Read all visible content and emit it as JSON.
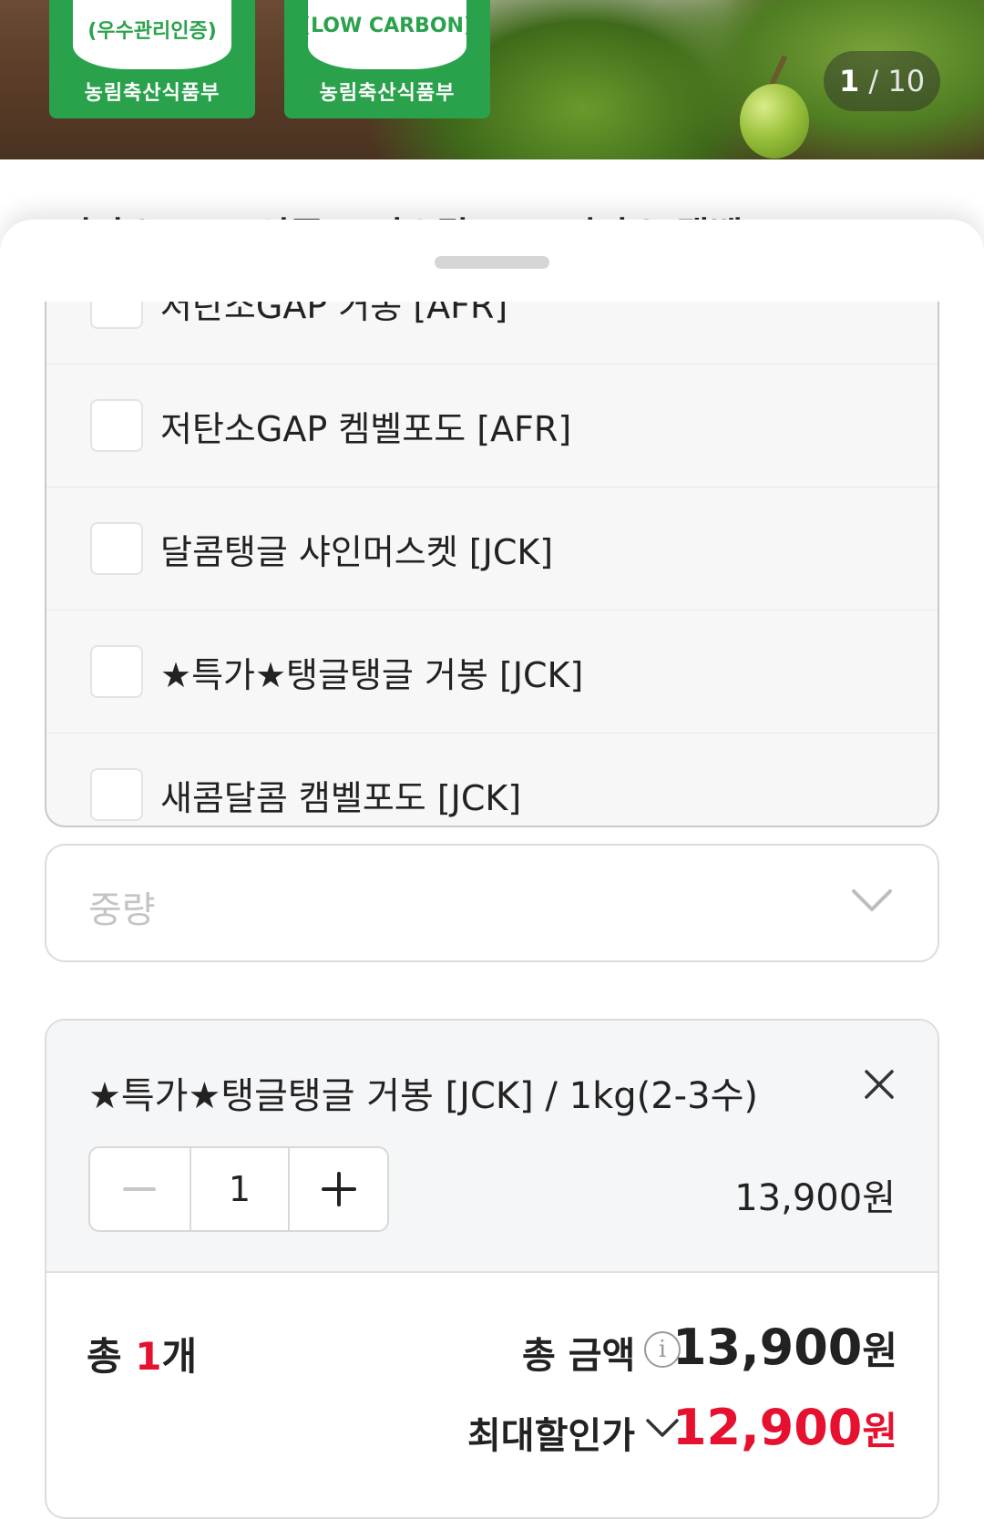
{
  "hero": {
    "badges": [
      {
        "sub": "(우수관리인증)",
        "ministry": "농림축산식품부"
      },
      {
        "sub": "(LOW CARBON)",
        "ministry": "농림축산식품부"
      }
    ],
    "pager": {
      "current": "1",
      "total": "/ 10"
    }
  },
  "product_title_partial": "저탄소 GAP인증 크리스탈 포도 저탄소 캠벨포도",
  "options": [
    {
      "label": "저탄소GAP 거봉 [AFR]",
      "checked": false
    },
    {
      "label": "저탄소GAP 켐벨포도 [AFR]",
      "checked": false
    },
    {
      "label": "달콤탱글 샤인머스켓 [JCK]",
      "checked": false
    },
    {
      "label": "★특가★탱글탱글 거봉 [JCK]",
      "checked": false
    },
    {
      "label": "새콤달콤 캠벨포도 [JCK]",
      "checked": false
    }
  ],
  "weight_select": {
    "placeholder": "중량"
  },
  "selected_item": {
    "name": "★특가★탱글탱글 거봉 [JCK] / 1kg(2-3수)",
    "quantity": "1",
    "price": "13,900원"
  },
  "summary": {
    "count_prefix": "총 ",
    "count_value": "1",
    "count_suffix": "개",
    "total_label": "총 금액",
    "total_value": "13,900",
    "total_unit": "원",
    "discount_label": "최대할인가",
    "discount_value": "12,900",
    "discount_unit": "원"
  },
  "colors": {
    "accent_red": "#e5112f",
    "badge_green": "#2aa24c"
  }
}
